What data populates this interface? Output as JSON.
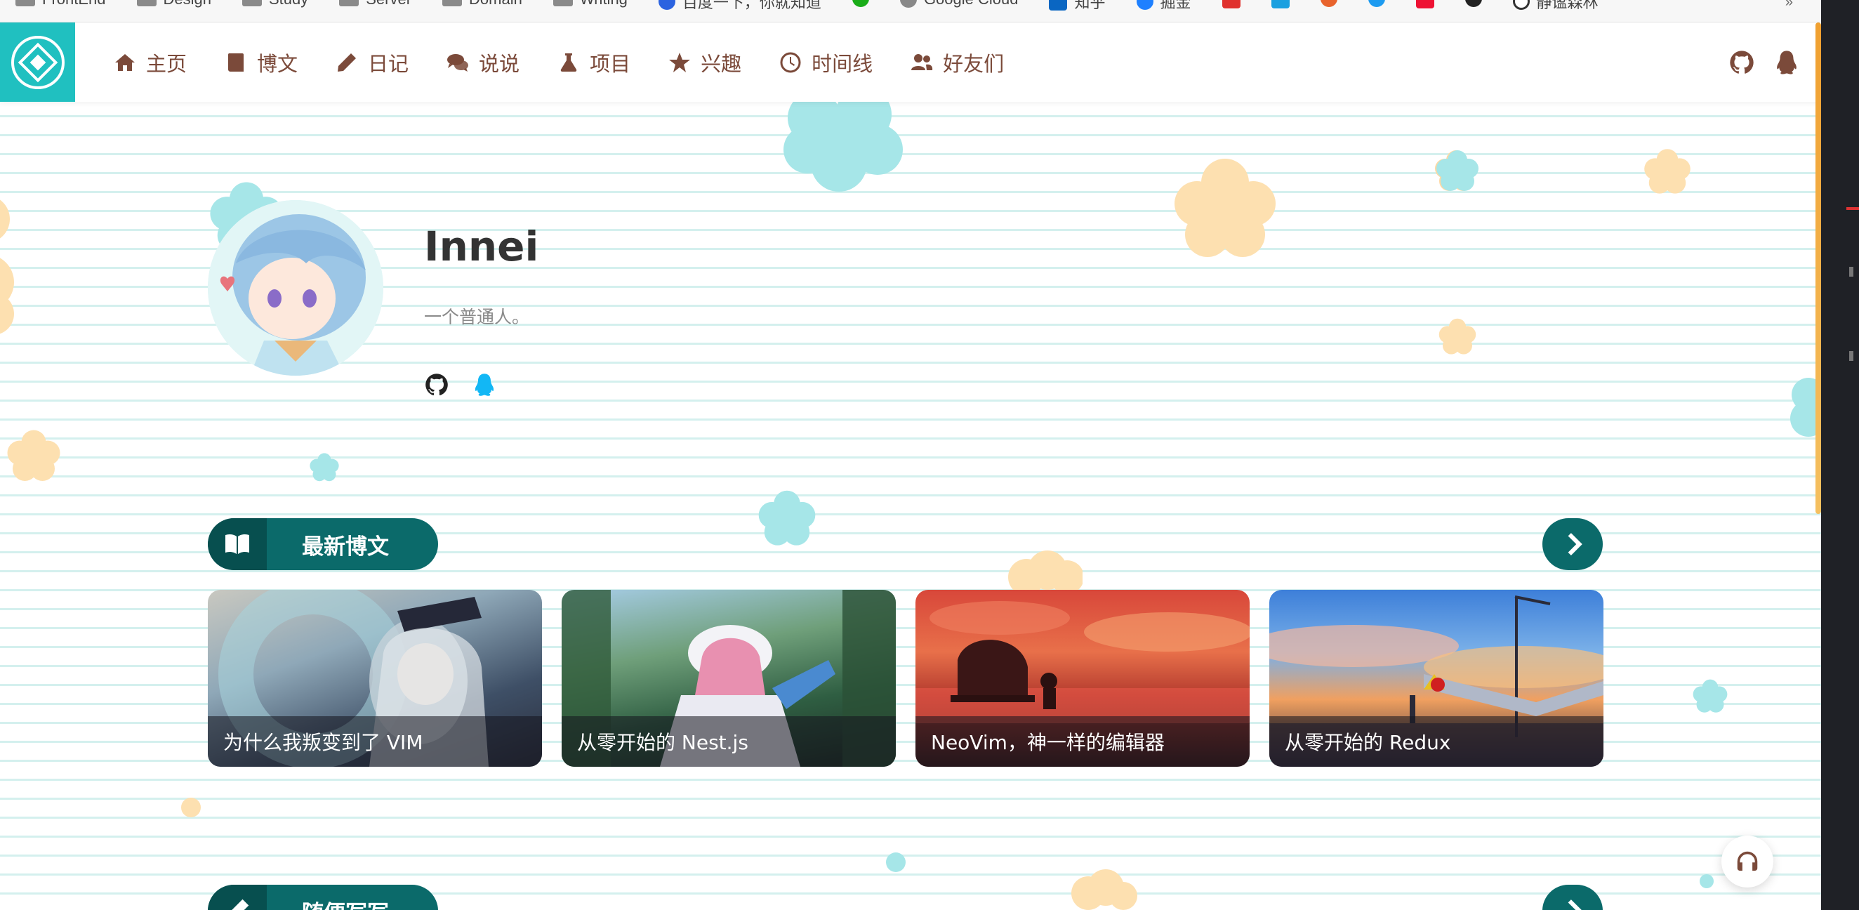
{
  "bookmarks_bar": {
    "items": [
      {
        "label": "FrontEnd",
        "kind": "folder"
      },
      {
        "label": "Design",
        "kind": "folder"
      },
      {
        "label": "Study",
        "kind": "folder"
      },
      {
        "label": "Server",
        "kind": "folder"
      },
      {
        "label": "Domain",
        "kind": "folder"
      },
      {
        "label": "Writing",
        "kind": "folder"
      },
      {
        "label": "百度一下，你就知道",
        "kind": "site",
        "icon_color": "#2b63e0"
      },
      {
        "label": "",
        "kind": "site",
        "icon_color": "#1aad19"
      },
      {
        "label": "Google Cloud",
        "kind": "site",
        "icon_color": "#888888"
      },
      {
        "label": "知乎",
        "kind": "site",
        "icon_color": "#0a66c2"
      },
      {
        "label": "掘金",
        "kind": "site",
        "icon_color": "#1e80ff"
      },
      {
        "label": "",
        "kind": "site",
        "icon_color": "#e0312e"
      },
      {
        "label": "",
        "kind": "site",
        "icon_color": "#1aa0e0"
      },
      {
        "label": "",
        "kind": "site",
        "icon_color": "#e8632c"
      },
      {
        "label": "",
        "kind": "site",
        "icon_color": "#1d9bf0"
      },
      {
        "label": "",
        "kind": "site",
        "icon_color": "#ee1133"
      },
      {
        "label": "",
        "kind": "site",
        "icon_color": "#222222"
      },
      {
        "label": "静谧森林",
        "kind": "site",
        "icon_color": "#333333"
      }
    ]
  },
  "nav": {
    "items": [
      {
        "label": "主页",
        "icon": "home-icon"
      },
      {
        "label": "博文",
        "icon": "book-icon"
      },
      {
        "label": "日记",
        "icon": "pencil-icon"
      },
      {
        "label": "说说",
        "icon": "comments-icon"
      },
      {
        "label": "项目",
        "icon": "flask-icon"
      },
      {
        "label": "兴趣",
        "icon": "star-icon"
      },
      {
        "label": "时间线",
        "icon": "clock-icon"
      },
      {
        "label": "好友们",
        "icon": "users-icon"
      }
    ],
    "right_icons": [
      "github-icon",
      "qq-icon"
    ]
  },
  "hero": {
    "name": "Innei",
    "tagline": "一个普通人。",
    "social": [
      "github-icon",
      "qq-icon"
    ]
  },
  "sections": {
    "latest_posts": {
      "title": "最新博文",
      "cards": [
        {
          "title": "为什么我叛变到了 VIM"
        },
        {
          "title": "从零开始的 Nest.js"
        },
        {
          "title": "NeoVim，神一样的编辑器"
        },
        {
          "title": "从零开始的 Redux"
        }
      ]
    },
    "notes": {
      "title": "随便写写"
    }
  },
  "colors": {
    "brand_teal": "#20c0c0",
    "section_teal": "#0b6a6a",
    "nav_text": "#7b4a3a",
    "flower_cyan": "#9ee4e4",
    "flower_orange": "#fddca0"
  }
}
